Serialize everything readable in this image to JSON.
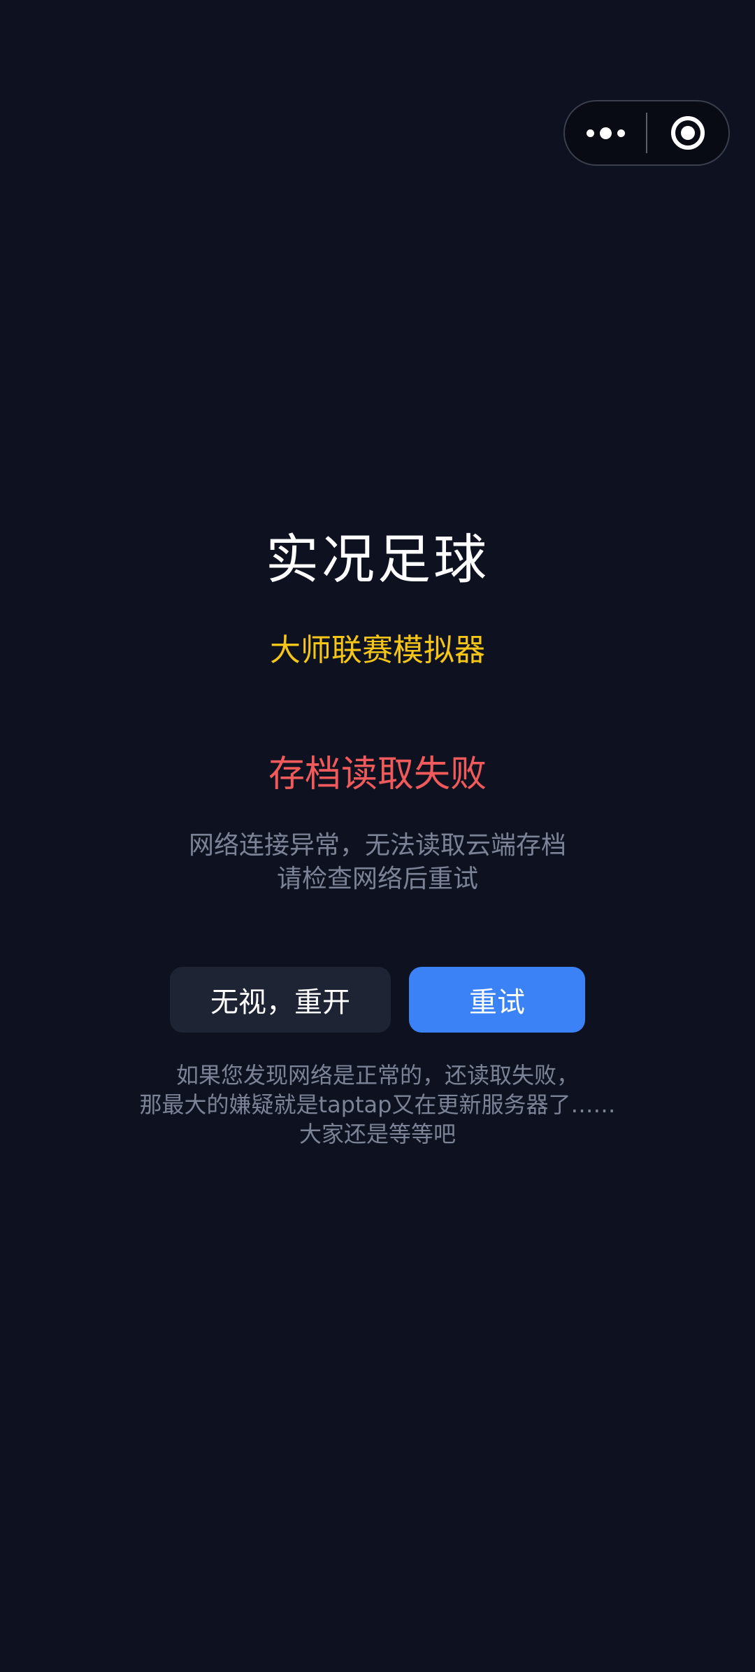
{
  "capsule": {
    "more_icon": "more-dots-icon",
    "close_icon": "close-target-icon"
  },
  "main": {
    "title": "实况足球",
    "subtitle": "大师联赛模拟器"
  },
  "error": {
    "title": "存档读取失败",
    "desc_line1": "网络连接异常，无法读取云端存档",
    "desc_line2": "请检查网络后重试"
  },
  "buttons": {
    "ignore_label": "无视，重开",
    "retry_label": "重试"
  },
  "note": {
    "line1": "如果您发现网络是正常的，还读取失败，",
    "line2": "那最大的嫌疑就是taptap又在更新服务器了……",
    "line3": "大家还是等等吧"
  },
  "colors": {
    "background": "#0e1220",
    "subtitle": "#f5c518",
    "error": "#f05a5a",
    "muted_text": "#7c8396",
    "primary_button": "#3b82f6",
    "secondary_button": "#1f2435"
  }
}
